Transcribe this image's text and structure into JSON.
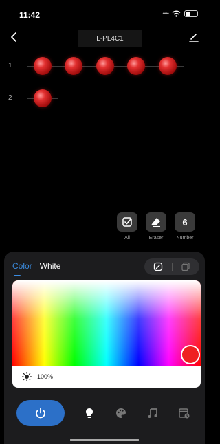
{
  "status": {
    "time": "11:42"
  },
  "nav": {
    "title": "L-PL4C1"
  },
  "rows": [
    {
      "label": "1",
      "led_count": 5,
      "led_color": "#d42020"
    },
    {
      "label": "2",
      "led_count": 1,
      "led_color": "#d42020"
    }
  ],
  "tools": [
    {
      "label": "All",
      "icon": "select-all-icon"
    },
    {
      "label": "Eraser",
      "icon": "eraser-icon"
    },
    {
      "label": "Number",
      "value": "6"
    }
  ],
  "tabs": {
    "color": "Color",
    "white": "White",
    "active": "Color"
  },
  "picker": {
    "selected_color": "#ef2020"
  },
  "brightness": {
    "value": "100%"
  },
  "bottom_nav": [
    "power-icon",
    "bulb-icon",
    "palette-icon",
    "music-icon",
    "schedule-icon"
  ],
  "accent_color": "#2c70c8"
}
